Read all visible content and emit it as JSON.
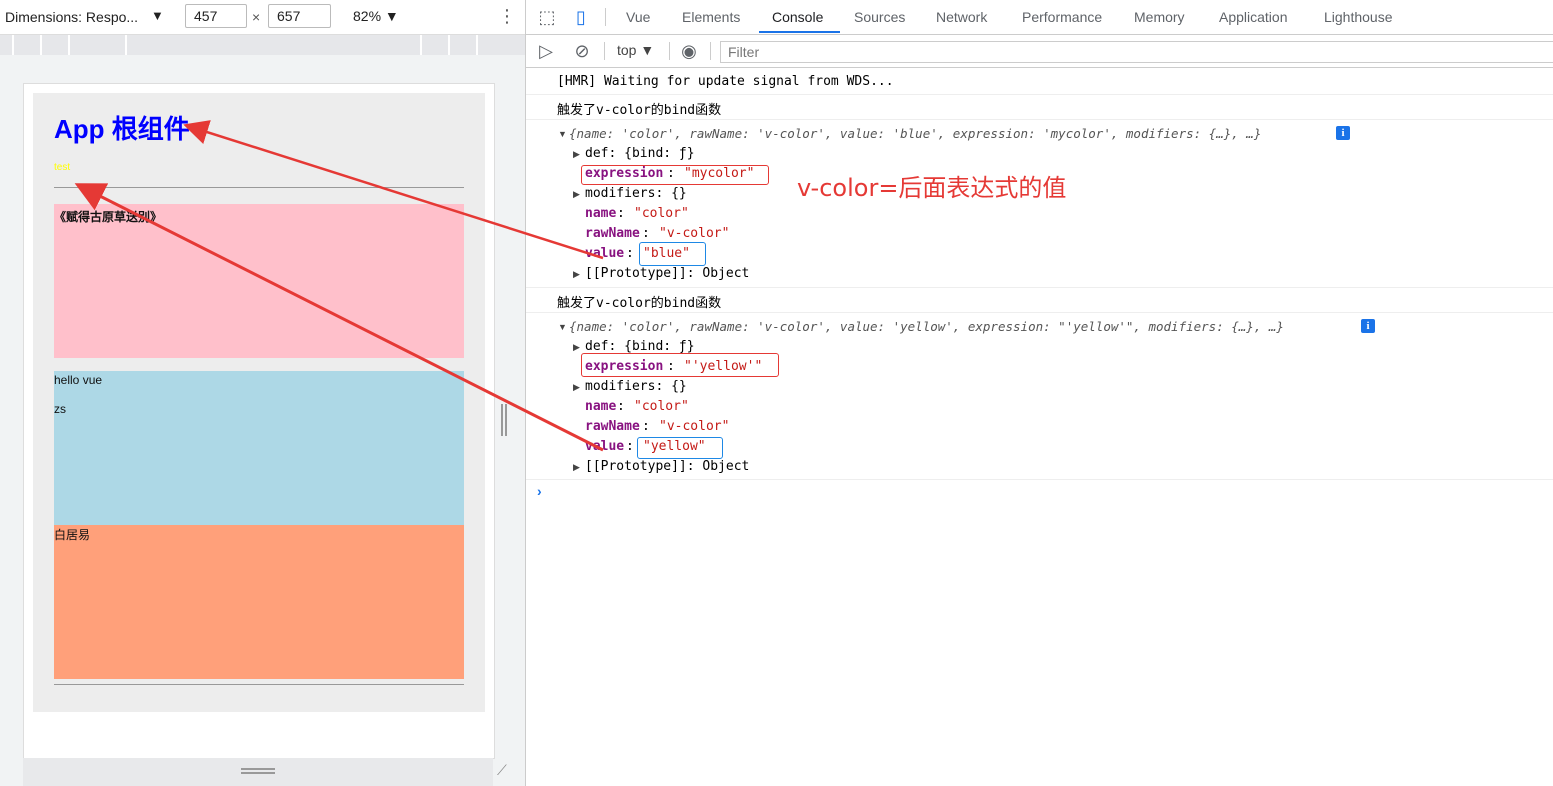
{
  "device_toolbar": {
    "dimensions_label": "Dimensions: Respo...",
    "caret": "▼",
    "width": "457",
    "times": "×",
    "height": "657",
    "zoom": "82% ▼",
    "more": "⋮"
  },
  "app": {
    "title": "App 根组件",
    "test": "test",
    "box1_text": "《赋得古原草送别》",
    "box2_line1": "hello vue",
    "box2_line2": "zs",
    "box3_text": "白居易",
    "colors": {
      "title": "#0000ff",
      "test": "#ffff00",
      "box1": "#ffc0cb",
      "box2": "#add8e6",
      "box3": "#ffa07a"
    }
  },
  "devtools": {
    "tabs": [
      "Vue",
      "Elements",
      "Console",
      "Sources",
      "Network",
      "Performance",
      "Memory",
      "Application",
      "Lighthouse"
    ],
    "active_tab": "Console",
    "context": "top",
    "filter_placeholder": "Filter"
  },
  "console": {
    "hmr": "[HMR] Waiting for update signal from WDS...",
    "bind_msg": "触发了v-color的bind函数",
    "obj1": {
      "summary": "{name: 'color', rawName: 'v-color', value: 'blue', expression: 'mycolor', modifiers: {…}, …}",
      "def": "def: {bind: ƒ}",
      "expression_key": "expression",
      "expression_val": "\"mycolor\"",
      "modifiers": "modifiers: {}",
      "name_key": "name",
      "name_val": "\"color\"",
      "rawName_key": "rawName",
      "rawName_val": "\"v-color\"",
      "value_key": "value",
      "value_val": "\"blue\"",
      "proto": "[[Prototype]]: Object"
    },
    "obj2": {
      "summary": "{name: 'color', rawName: 'v-color', value: 'yellow', expression: \"'yellow'\", modifiers: {…}, …}",
      "def": "def: {bind: ƒ}",
      "expression_key": "expression",
      "expression_val": "\"'yellow'\"",
      "modifiers": "modifiers: {}",
      "name_key": "name",
      "name_val": "\"color\"",
      "rawName_key": "rawName",
      "rawName_val": "\"v-color\"",
      "value_key": "value",
      "value_val": "\"yellow\"",
      "proto": "[[Prototype]]: Object"
    },
    "annotation": "v-color=后面表达式的值",
    "prompt": "›"
  }
}
